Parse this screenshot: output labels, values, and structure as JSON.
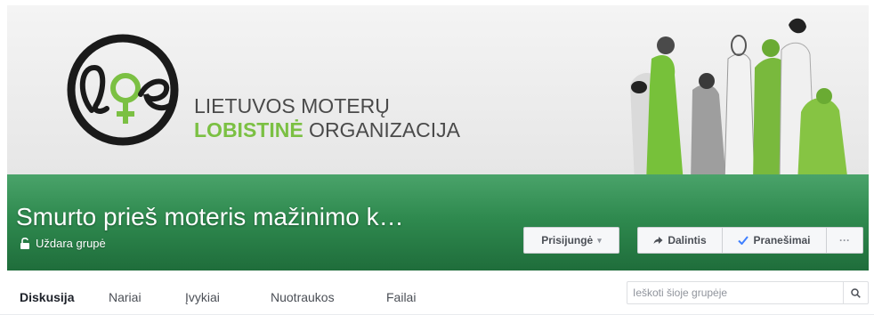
{
  "cover": {
    "logo_line1": "LIETUVOS MOTERŲ",
    "logo_line2_bold": "LOBISTINĖ",
    "logo_line2_light": " ORGANIZACIJA",
    "logo_icon": "loe-logo-icon",
    "illustration": "women-illustration"
  },
  "header": {
    "group_title": "Smurto prieš moteris mažinimo k…",
    "group_type": "Uždara grupė",
    "lock_icon": "lock-open-icon"
  },
  "actions": {
    "joined_label": "Prisijungė",
    "joined_caret": "▾",
    "share_label": "Dalintis",
    "share_icon": "share-arrow-icon",
    "notifications_label": "Pranešimai",
    "notifications_icon": "checkmark-icon",
    "more_label": "···"
  },
  "tabs": [
    {
      "label": "Diskusija",
      "active": true
    },
    {
      "label": "Nariai",
      "active": false
    },
    {
      "label": "Įvykiai",
      "active": false
    },
    {
      "label": "Nuotraukos",
      "active": false
    },
    {
      "label": "Failai",
      "active": false
    }
  ],
  "search": {
    "placeholder": "Ieškoti šioje grupėje",
    "icon": "search-icon"
  },
  "colors": {
    "green_band": "#2f8a4f",
    "logo_green": "#7bc043",
    "logo_dark": "#1a1a1a",
    "check_blue": "#4080ff"
  }
}
